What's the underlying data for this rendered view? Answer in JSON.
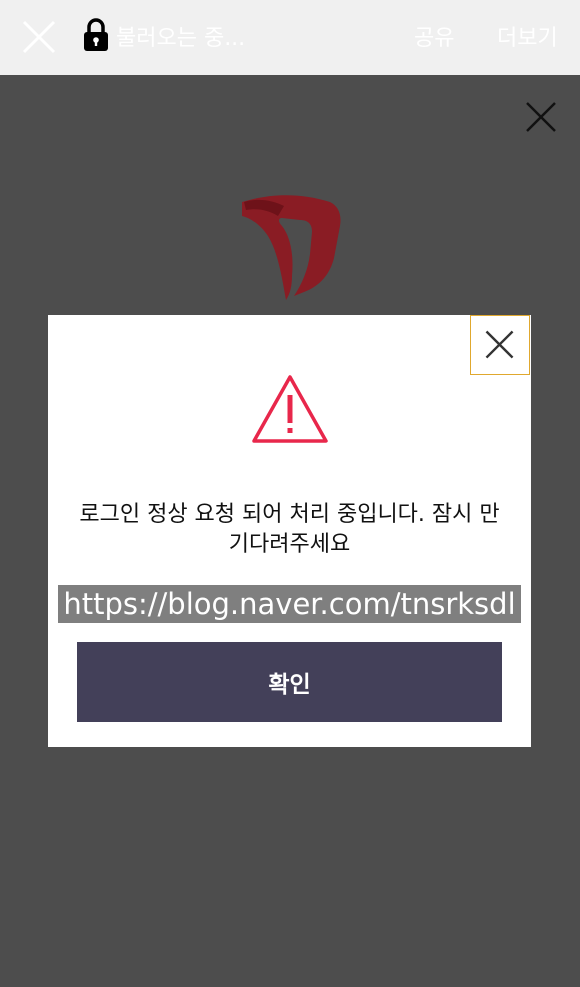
{
  "topbar": {
    "title": "불러오는 중...",
    "share_label": "공유",
    "more_label": "더보기"
  },
  "dialog": {
    "message": "로그인 정상 요청 되어 처리 중입니다. 잠시 만 기다려주세요",
    "url": "https://blog.naver.com/tnsrksdl",
    "confirm_label": "확인"
  },
  "colors": {
    "overlay": "#4d4d4d",
    "warning": "#e8274b",
    "button": "#434059",
    "logo": "#8a1c24",
    "focus_border": "#e0a82e"
  },
  "icons": {
    "close": "close-icon",
    "lock": "lock-icon",
    "warning": "warning-triangle-icon"
  }
}
